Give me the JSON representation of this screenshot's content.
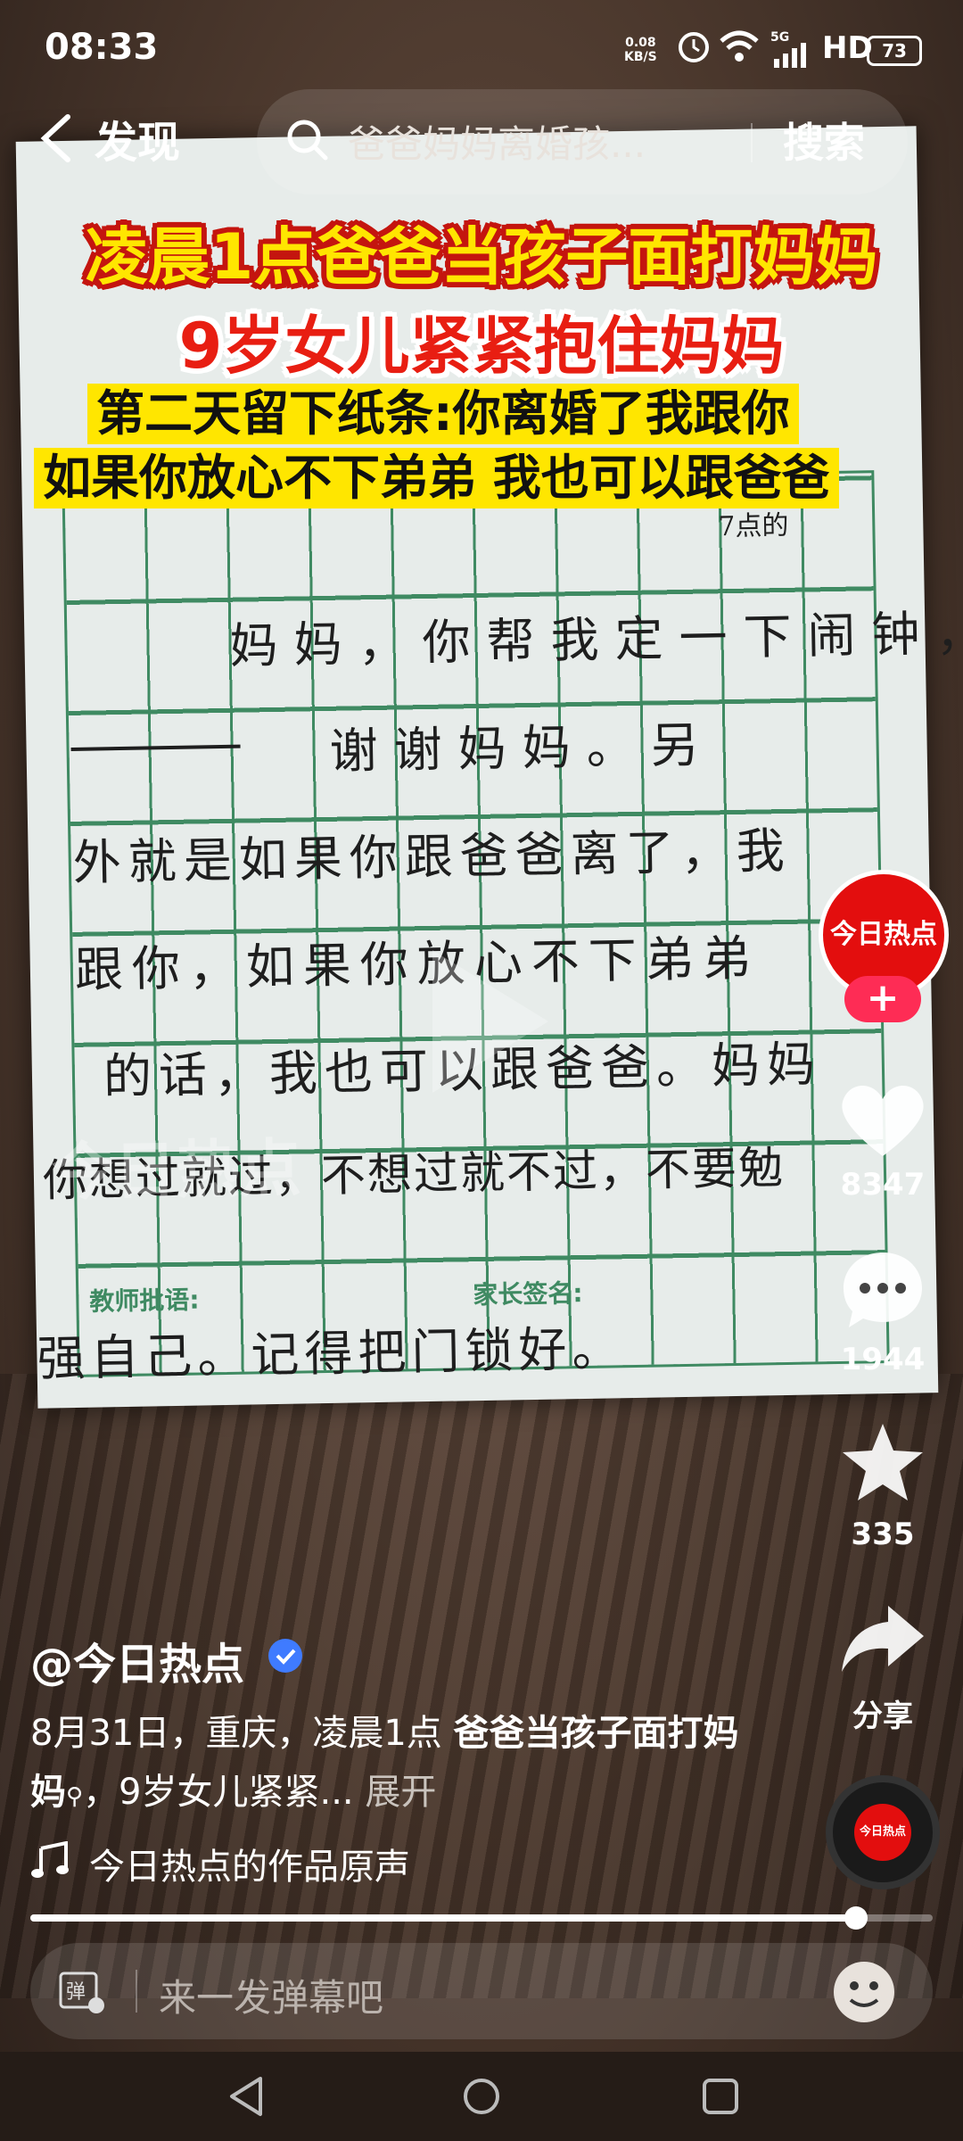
{
  "status_bar": {
    "time": "08:33",
    "network_speed": "0.08",
    "network_unit": "KB/S",
    "signal": "5G",
    "hd": "HD",
    "battery": "73"
  },
  "nav": {
    "back_label": "发现",
    "search_query": "爸爸妈妈离婚孩...",
    "search_button": "搜索"
  },
  "video": {
    "headline_line1": "凌晨1点爸爸当孩子面打妈妈",
    "headline_line2": "9岁女儿紧紧抱住妈妈",
    "subline1": "第二天留下纸条:你离婚了我跟你",
    "subline2": "如果你放心不下弟弟 我也可以跟爸爸",
    "note_lines": [
      "妈妈，你帮我定一下闹钟，",
      "谢谢妈妈。另",
      "外就是如果你跟爸爸离了，我",
      "跟你，如果你放心不下弟弟",
      "的话，我也可以跟爸爸。妈妈",
      "你想过就过，不想过就不过，不要勉",
      "强自己。记得把门锁好。"
    ],
    "note_corner": "7点的",
    "teacher_label": "教师批语:",
    "parent_label": "家长签名:",
    "watermark": "今日热点"
  },
  "rail": {
    "avatar_text": "今日热点",
    "likes": "8347",
    "comments": "1944",
    "favorites": "335",
    "share": "分享",
    "disc_text": "今日热点"
  },
  "info": {
    "handle": "@今日热点",
    "desc_plain": "8月31日，重庆，凌晨1点 ",
    "desc_bold": "爸爸当孩子面打妈妈",
    "desc_rest": "，9岁女儿紧紧...",
    "desc_more": "展开",
    "music": "今日热点的作品原声"
  },
  "player": {
    "progress": 0.915
  },
  "danmu": {
    "placeholder": "来一发弹幕吧"
  },
  "colors": {
    "accent_red": "#fe2c55",
    "brand_red": "#e30e0e",
    "headline_yellow": "#ffe600",
    "verified_blue": "#3f7bff"
  }
}
